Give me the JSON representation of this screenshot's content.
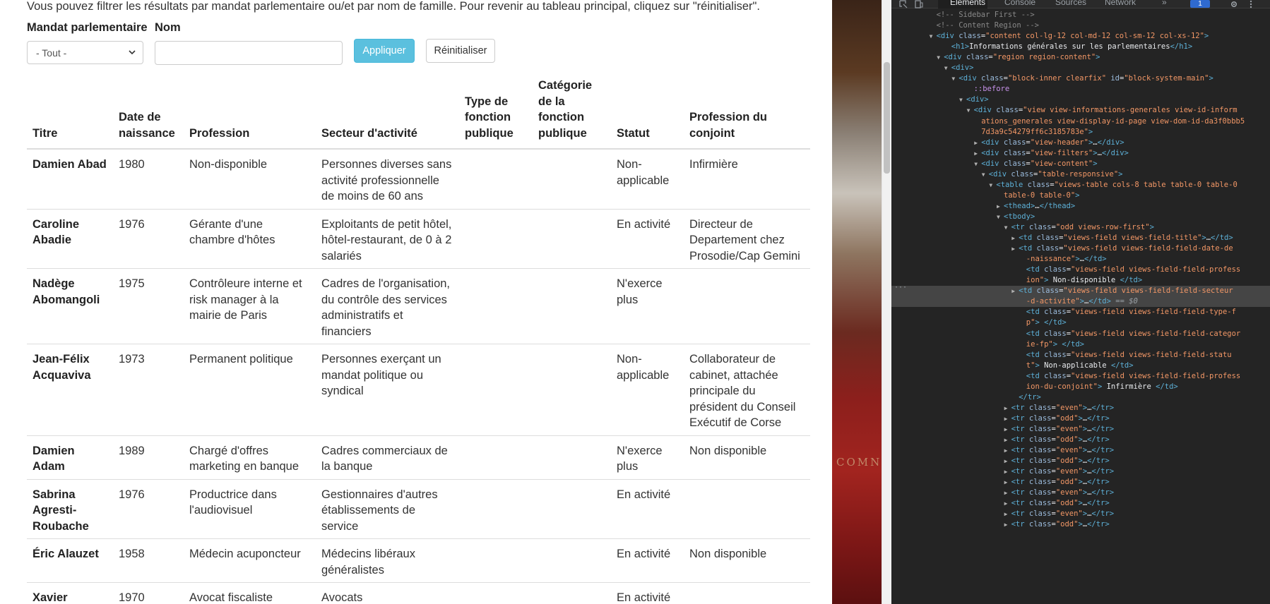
{
  "intro_text": "Vous pouvez filtrer les résultats par mandat parlementaire ou/et par nom de famille. Pour revenir au tableau principal, cliquez sur \"réinitialiser\".",
  "filters": {
    "mandat_label": "Mandat parlementaire",
    "mandat_value": "- Tout -",
    "nom_label": "Nom",
    "nom_value": "",
    "apply_label": "Appliquer",
    "reset_label": "Réinitialiser"
  },
  "table": {
    "columns": [
      "Titre",
      "Date de naissance",
      "Profession",
      "Secteur d'activité",
      "Type de fonction publique",
      "Catégorie de la fonction publique",
      "Statut",
      "Profession du conjoint"
    ],
    "rows": [
      [
        "Damien Abad",
        "1980",
        "Non-disponible",
        "Personnes diverses sans activité professionnelle de moins de 60 ans",
        "",
        "",
        "Non-applicable",
        "Infirmière"
      ],
      [
        "Caroline Abadie",
        "1976",
        "Gérante d'une chambre d'hôtes",
        "Exploitants de petit hôtel, hôtel-restaurant, de 0 à 2 salariés",
        "",
        "",
        "En activité",
        "Directeur de Departement chez Prosodie/Cap Gemini"
      ],
      [
        "Nadège Abomangoli",
        "1975",
        "Contrôleure interne et risk manager à la mairie de Paris",
        "Cadres de l'organisation, du contrôle des services administratifs et financiers",
        "",
        "",
        "N'exerce plus",
        ""
      ],
      [
        "Jean-Félix Acquaviva",
        "1973",
        "Permanent politique",
        "Personnes exerçant un mandat politique ou syndical",
        "",
        "",
        "Non-applicable",
        "Collaborateur de cabinet, attachée principale du président du Conseil Exécutif de Corse"
      ],
      [
        "Damien Adam",
        "1989",
        "Chargé d'offres marketing en banque",
        "Cadres commerciaux de la banque",
        "",
        "",
        "N'exerce plus",
        "Non disponible"
      ],
      [
        "Sabrina Agresti-Roubache",
        "1976",
        "Productrice dans l'audiovisuel",
        "Gestionnaires d'autres établissements de service",
        "",
        "",
        "En activité",
        ""
      ],
      [
        "Éric Alauzet",
        "1958",
        "Médecin acuponcteur",
        "Médecins libéraux généralistes",
        "",
        "",
        "En activité",
        "Non disponible"
      ],
      [
        "Xavier Albertini",
        "1970",
        "Avocat fiscaliste",
        "Avocats",
        "",
        "",
        "En activité",
        ""
      ]
    ]
  },
  "background_lettering": "COMN",
  "devtools": {
    "tabs": [
      "Elements",
      "Console",
      "Sources",
      "Network",
      "»"
    ],
    "active_tab": "Elements",
    "badge": "1",
    "lines": [
      {
        "indent": 6,
        "tw": "",
        "html": "<span class='cm'>&lt;!-- Sidebar First --&gt;</span>"
      },
      {
        "indent": 6,
        "tw": "",
        "html": "<span class='cm'>&lt;!-- Content Region --&gt;</span>"
      },
      {
        "indent": 6,
        "tw": "▼",
        "html": "<span class='tag'>&lt;div</span> <span class='an'>class</span>=<span class='av'>\"content col-lg-12 col-md-12 col-sm-12 col-xs-12\"</span><span class='tag'>&gt;</span>"
      },
      {
        "indent": 8,
        "tw": "",
        "html": "<span class='tag'>&lt;h1&gt;</span><span class='tx'>Informations générales sur les parlementaires</span><span class='tag'>&lt;/h1&gt;</span>"
      },
      {
        "indent": 7,
        "tw": "▼",
        "html": "<span class='tag'>&lt;div</span> <span class='an'>class</span>=<span class='av'>\"region region-content\"</span><span class='tag'>&gt;</span>"
      },
      {
        "indent": 8,
        "tw": "▼",
        "html": "<span class='tag'>&lt;div&gt;</span>"
      },
      {
        "indent": 9,
        "tw": "▼",
        "html": "<span class='tag'>&lt;div</span> <span class='an'>class</span>=<span class='av'>\"block-inner clearfix\"</span> <span class='an'>id</span>=<span class='av'>\"block-system-main\"</span><span class='tag'>&gt;</span>"
      },
      {
        "indent": 11,
        "tw": "",
        "html": "<span class='ps'>::before</span>"
      },
      {
        "indent": 10,
        "tw": "▼",
        "html": "<span class='tag'>&lt;div&gt;</span>"
      },
      {
        "indent": 11,
        "tw": "▼",
        "html": "<span class='tag'>&lt;div</span> <span class='an'>class</span>=<span class='av'>\"view view-informations-generales view-id-inform</span>"
      },
      {
        "indent": 12,
        "tw": "",
        "html": "<span class='av'>ations_generales view-display-id-page view-dom-id-da3f0bbb5</span>"
      },
      {
        "indent": 12,
        "tw": "",
        "html": "<span class='av'>7d3a9c54279ff6c3185783e\"</span><span class='tag'>&gt;</span>"
      },
      {
        "indent": 12,
        "tw": "▶",
        "html": "<span class='tag'>&lt;div</span> <span class='an'>class</span>=<span class='av'>\"view-header\"</span><span class='tag'>&gt;</span><span class='tx'>…</span><span class='tag'>&lt;/div&gt;</span>"
      },
      {
        "indent": 12,
        "tw": "▶",
        "html": "<span class='tag'>&lt;div</span> <span class='an'>class</span>=<span class='av'>\"view-filters\"</span><span class='tag'>&gt;</span><span class='tx'>…</span><span class='tag'>&lt;/div&gt;</span>"
      },
      {
        "indent": 12,
        "tw": "▼",
        "html": "<span class='tag'>&lt;div</span> <span class='an'>class</span>=<span class='av'>\"view-content\"</span><span class='tag'>&gt;</span>"
      },
      {
        "indent": 13,
        "tw": "▼",
        "html": "<span class='tag'>&lt;div</span> <span class='an'>class</span>=<span class='av'>\"table-responsive\"</span><span class='tag'>&gt;</span>"
      },
      {
        "indent": 14,
        "tw": "▼",
        "html": "<span class='tag'>&lt;table</span> <span class='an'>class</span>=<span class='av'>\"views-table cols-8 table table-0 table-0</span>"
      },
      {
        "indent": 15,
        "tw": "",
        "html": "<span class='av'>table-0 table-0\"</span><span class='tag'>&gt;</span>"
      },
      {
        "indent": 15,
        "tw": "▶",
        "html": "<span class='tag'>&lt;thead&gt;</span><span class='tx'>…</span><span class='tag'>&lt;/thead&gt;</span>"
      },
      {
        "indent": 15,
        "tw": "▼",
        "html": "<span class='tag'>&lt;tbody&gt;</span>"
      },
      {
        "indent": 16,
        "tw": "▼",
        "html": "<span class='tag'>&lt;tr</span> <span class='an'>class</span>=<span class='av'>\"odd views-row-first\"</span><span class='tag'>&gt;</span>"
      },
      {
        "indent": 17,
        "tw": "▶",
        "html": "<span class='tag'>&lt;td</span> <span class='an'>class</span>=<span class='av'>\"views-field views-field-title\"</span><span class='tag'>&gt;</span><span class='tx'>…</span><span class='tag'>&lt;/td&gt;</span>"
      },
      {
        "indent": 17,
        "tw": "▶",
        "html": "<span class='tag'>&lt;td</span> <span class='an'>class</span>=<span class='av'>\"views-field views-field-field-date-de</span>"
      },
      {
        "indent": 18,
        "tw": "",
        "html": "<span class='av'>-naissance\"</span><span class='tag'>&gt;</span><span class='tx'>…</span><span class='tag'>&lt;/td&gt;</span>"
      },
      {
        "indent": 18,
        "tw": "",
        "html": "<span class='tag'>&lt;td</span> <span class='an'>class</span>=<span class='av'>\"views-field views-field-field-profess</span>"
      },
      {
        "indent": 18,
        "tw": "",
        "html": "<span class='av'>ion\"</span><span class='tag'>&gt;</span><span class='tx'> Non-disponible </span><span class='tag'>&lt;/td&gt;</span>"
      },
      {
        "indent": 17,
        "tw": "▶",
        "sel": true,
        "html": "<span class='tag'>&lt;td</span> <span class='an'>class</span>=<span class='av'>\"views-field views-field-field-secteur</span>"
      },
      {
        "indent": 18,
        "tw": "",
        "sel": true,
        "html": "<span class='av'>-d-activite\"</span><span class='tag'>&gt;</span><span class='tx'>…</span><span class='tag'>&lt;/td&gt;</span> <span class='eq'>== $0</span>"
      },
      {
        "indent": 18,
        "tw": "",
        "html": "<span class='tag'>&lt;td</span> <span class='an'>class</span>=<span class='av'>\"views-field views-field-field-type-f</span>"
      },
      {
        "indent": 18,
        "tw": "",
        "html": "<span class='av'>p\"</span><span class='tag'>&gt;</span><span class='tx'> </span><span class='tag'>&lt;/td&gt;</span>"
      },
      {
        "indent": 18,
        "tw": "",
        "html": "<span class='tag'>&lt;td</span> <span class='an'>class</span>=<span class='av'>\"views-field views-field-field-categor</span>"
      },
      {
        "indent": 18,
        "tw": "",
        "html": "<span class='av'>ie-fp\"</span><span class='tag'>&gt;</span><span class='tx'> </span><span class='tag'>&lt;/td&gt;</span>"
      },
      {
        "indent": 18,
        "tw": "",
        "html": "<span class='tag'>&lt;td</span> <span class='an'>class</span>=<span class='av'>\"views-field views-field-field-statu</span>"
      },
      {
        "indent": 18,
        "tw": "",
        "html": "<span class='av'>t\"</span><span class='tag'>&gt;</span><span class='tx'> Non-applicable </span><span class='tag'>&lt;/td&gt;</span>"
      },
      {
        "indent": 18,
        "tw": "",
        "html": "<span class='tag'>&lt;td</span> <span class='an'>class</span>=<span class='av'>\"views-field views-field-field-profess</span>"
      },
      {
        "indent": 18,
        "tw": "",
        "html": "<span class='av'>ion-du-conjoint\"</span><span class='tag'>&gt;</span><span class='tx'> Infirmière </span><span class='tag'>&lt;/td&gt;</span>"
      },
      {
        "indent": 17,
        "tw": "",
        "html": "<span class='tag'>&lt;/tr&gt;</span>"
      },
      {
        "indent": 16,
        "tw": "▶",
        "html": "<span class='tag'>&lt;tr</span> <span class='an'>class</span>=<span class='av'>\"even\"</span><span class='tag'>&gt;</span><span class='tx'>…</span><span class='tag'>&lt;/tr&gt;</span>"
      },
      {
        "indent": 16,
        "tw": "▶",
        "html": "<span class='tag'>&lt;tr</span> <span class='an'>class</span>=<span class='av'>\"odd\"</span><span class='tag'>&gt;</span><span class='tx'>…</span><span class='tag'>&lt;/tr&gt;</span>"
      },
      {
        "indent": 16,
        "tw": "▶",
        "html": "<span class='tag'>&lt;tr</span> <span class='an'>class</span>=<span class='av'>\"even\"</span><span class='tag'>&gt;</span><span class='tx'>…</span><span class='tag'>&lt;/tr&gt;</span>"
      },
      {
        "indent": 16,
        "tw": "▶",
        "html": "<span class='tag'>&lt;tr</span> <span class='an'>class</span>=<span class='av'>\"odd\"</span><span class='tag'>&gt;</span><span class='tx'>…</span><span class='tag'>&lt;/tr&gt;</span>"
      },
      {
        "indent": 16,
        "tw": "▶",
        "html": "<span class='tag'>&lt;tr</span> <span class='an'>class</span>=<span class='av'>\"even\"</span><span class='tag'>&gt;</span><span class='tx'>…</span><span class='tag'>&lt;/tr&gt;</span>"
      },
      {
        "indent": 16,
        "tw": "▶",
        "html": "<span class='tag'>&lt;tr</span> <span class='an'>class</span>=<span class='av'>\"odd\"</span><span class='tag'>&gt;</span><span class='tx'>…</span><span class='tag'>&lt;/tr&gt;</span>"
      },
      {
        "indent": 16,
        "tw": "▶",
        "html": "<span class='tag'>&lt;tr</span> <span class='an'>class</span>=<span class='av'>\"even\"</span><span class='tag'>&gt;</span><span class='tx'>…</span><span class='tag'>&lt;/tr&gt;</span>"
      },
      {
        "indent": 16,
        "tw": "▶",
        "html": "<span class='tag'>&lt;tr</span> <span class='an'>class</span>=<span class='av'>\"odd\"</span><span class='tag'>&gt;</span><span class='tx'>…</span><span class='tag'>&lt;/tr&gt;</span>"
      },
      {
        "indent": 16,
        "tw": "▶",
        "html": "<span class='tag'>&lt;tr</span> <span class='an'>class</span>=<span class='av'>\"even\"</span><span class='tag'>&gt;</span><span class='tx'>…</span><span class='tag'>&lt;/tr&gt;</span>"
      },
      {
        "indent": 16,
        "tw": "▶",
        "html": "<span class='tag'>&lt;tr</span> <span class='an'>class</span>=<span class='av'>\"odd\"</span><span class='tag'>&gt;</span><span class='tx'>…</span><span class='tag'>&lt;/tr&gt;</span>"
      },
      {
        "indent": 16,
        "tw": "▶",
        "html": "<span class='tag'>&lt;tr</span> <span class='an'>class</span>=<span class='av'>\"even\"</span><span class='tag'>&gt;</span><span class='tx'>…</span><span class='tag'>&lt;/tr&gt;</span>"
      },
      {
        "indent": 16,
        "tw": "▶",
        "html": "<span class='tag'>&lt;tr</span> <span class='an'>class</span>=<span class='av'>\"odd\"</span><span class='tag'>&gt;</span><span class='tx'>…</span><span class='tag'>&lt;/tr&gt;</span>"
      }
    ]
  }
}
